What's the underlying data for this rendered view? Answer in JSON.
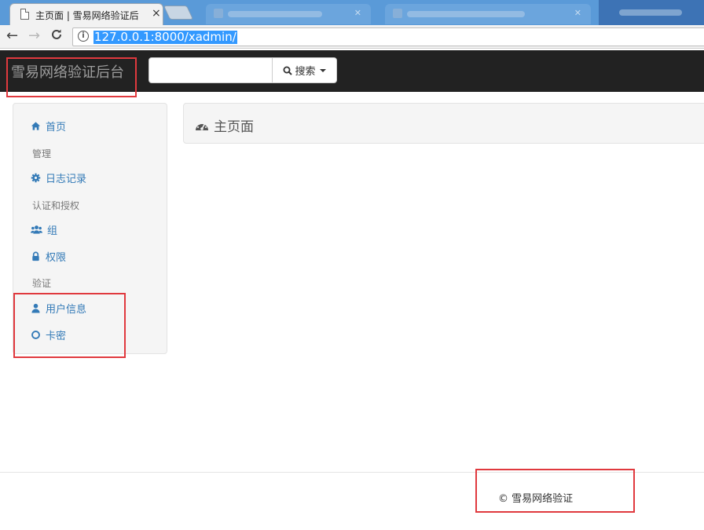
{
  "browser": {
    "active_tab_title": "主页面 | 雪易网络验证后",
    "close_glyph": "×",
    "url": "127.0.0.1:8000/xadmin/",
    "back_glyph": "←",
    "forward_glyph": "→",
    "reload_glyph": "C",
    "info_glyph": "i"
  },
  "navbar": {
    "brand": "雪易网络验证后台",
    "search_label": "搜索",
    "search_placeholder": ""
  },
  "sidebar": {
    "home": "首页",
    "sections": [
      {
        "header": "管理",
        "items": [
          {
            "label": "日志记录",
            "icon": "gear-icon"
          }
        ]
      },
      {
        "header": "认证和授权",
        "items": [
          {
            "label": "组",
            "icon": "users-icon"
          },
          {
            "label": "权限",
            "icon": "lock-icon"
          }
        ]
      },
      {
        "header": "验证",
        "items": [
          {
            "label": "用户信息",
            "icon": "user-icon"
          },
          {
            "label": "卡密",
            "icon": "circle-icon"
          }
        ]
      }
    ]
  },
  "main": {
    "page_title": "主页面"
  },
  "footer": {
    "copyright": "© 雪易网络验证"
  },
  "colors": {
    "navbar_bg": "#222222",
    "link": "#337ab7",
    "annotation": "#e0393e"
  }
}
